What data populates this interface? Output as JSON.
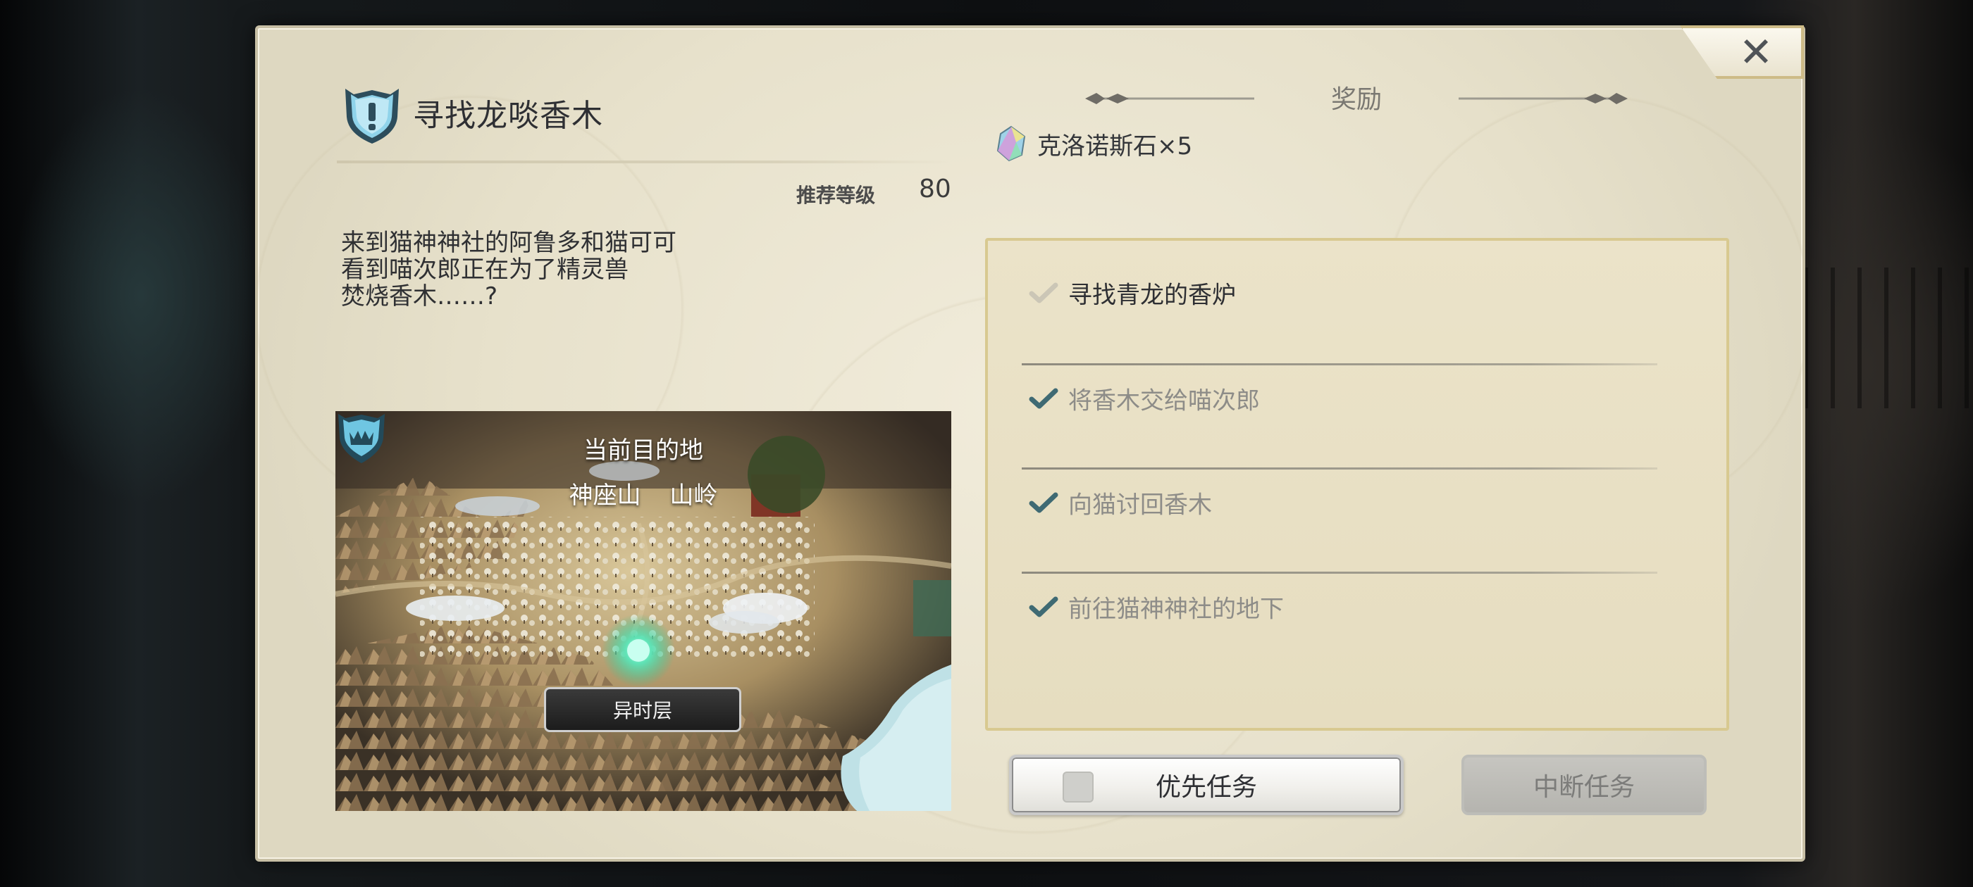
{
  "quest": {
    "title": "寻找龙啖香木",
    "level_label": "推荐等级",
    "level_value": "80",
    "description": [
      "来到猫神神社的阿鲁多和猫可可",
      "看到喵次郎正在为了精灵兽",
      "焚烧香木……?"
    ]
  },
  "map": {
    "destination_label": "当前目的地",
    "destination_name": "神座山 山岭",
    "location_tag": "异时层"
  },
  "rewards": {
    "header": "奖励",
    "items": [
      {
        "icon": "chronos-stone-icon",
        "text": "克洛诺斯石×5"
      }
    ]
  },
  "objectives": [
    {
      "text": "寻找青龙的香炉",
      "status": "active"
    },
    {
      "text": "将香木交给喵次郎",
      "status": "done"
    },
    {
      "text": "向猫讨回香木",
      "status": "done"
    },
    {
      "text": "前往猫神神社的地下",
      "status": "done"
    }
  ],
  "buttons": {
    "priority": "优先任务",
    "priority_checked": false,
    "abort": "中断任务",
    "close_icon": "close-icon"
  },
  "colors": {
    "panel_bg": "#ebe6d3",
    "check_done": "#3f6a73",
    "check_active": "#c9c4b4",
    "objective_box_border": "#d8c990"
  }
}
